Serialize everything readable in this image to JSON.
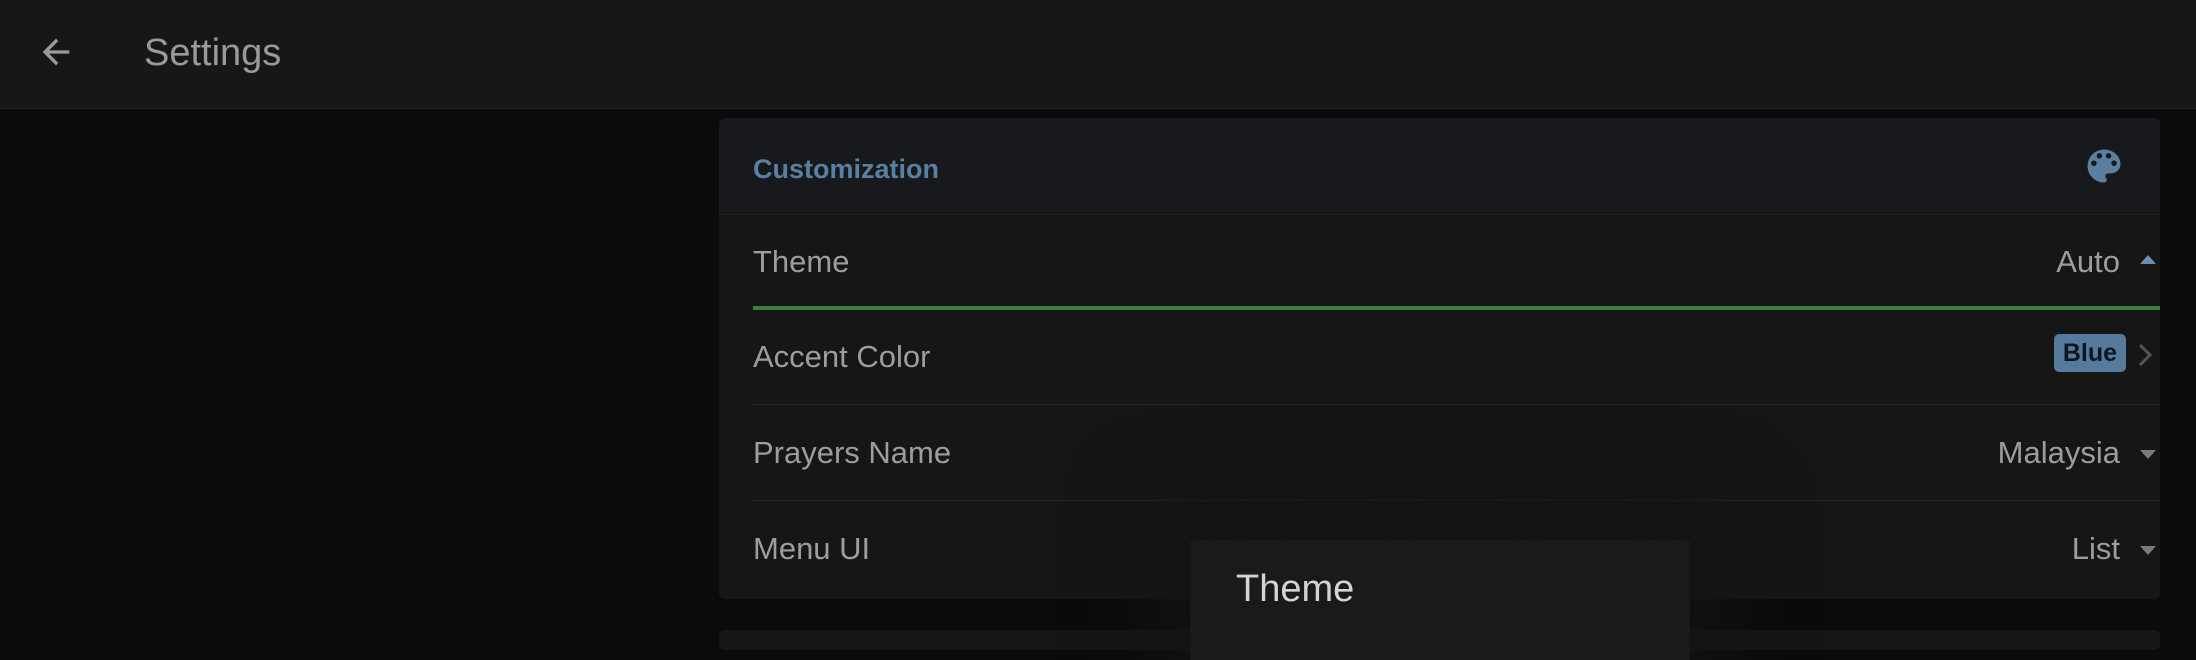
{
  "appbar": {
    "title": "Settings",
    "back_icon": "arrow-left-icon"
  },
  "customization": {
    "header": "Customization",
    "header_icon": "palette-icon",
    "accent_hex": "#5a7fa0",
    "rows": [
      {
        "label": "Theme",
        "value": "Auto",
        "control": "dropdown-open"
      },
      {
        "label": "Accent Color",
        "value": "Blue",
        "control": "badge-chevron"
      },
      {
        "label": "Prayers Name",
        "value": "Malaysia",
        "control": "dropdown"
      },
      {
        "label": "Menu UI",
        "value": "List",
        "control": "dropdown"
      }
    ]
  },
  "dialog": {
    "title": "Theme"
  },
  "colors": {
    "active_underline": "#3b7f3e",
    "badge_bg": "#557a9c"
  }
}
